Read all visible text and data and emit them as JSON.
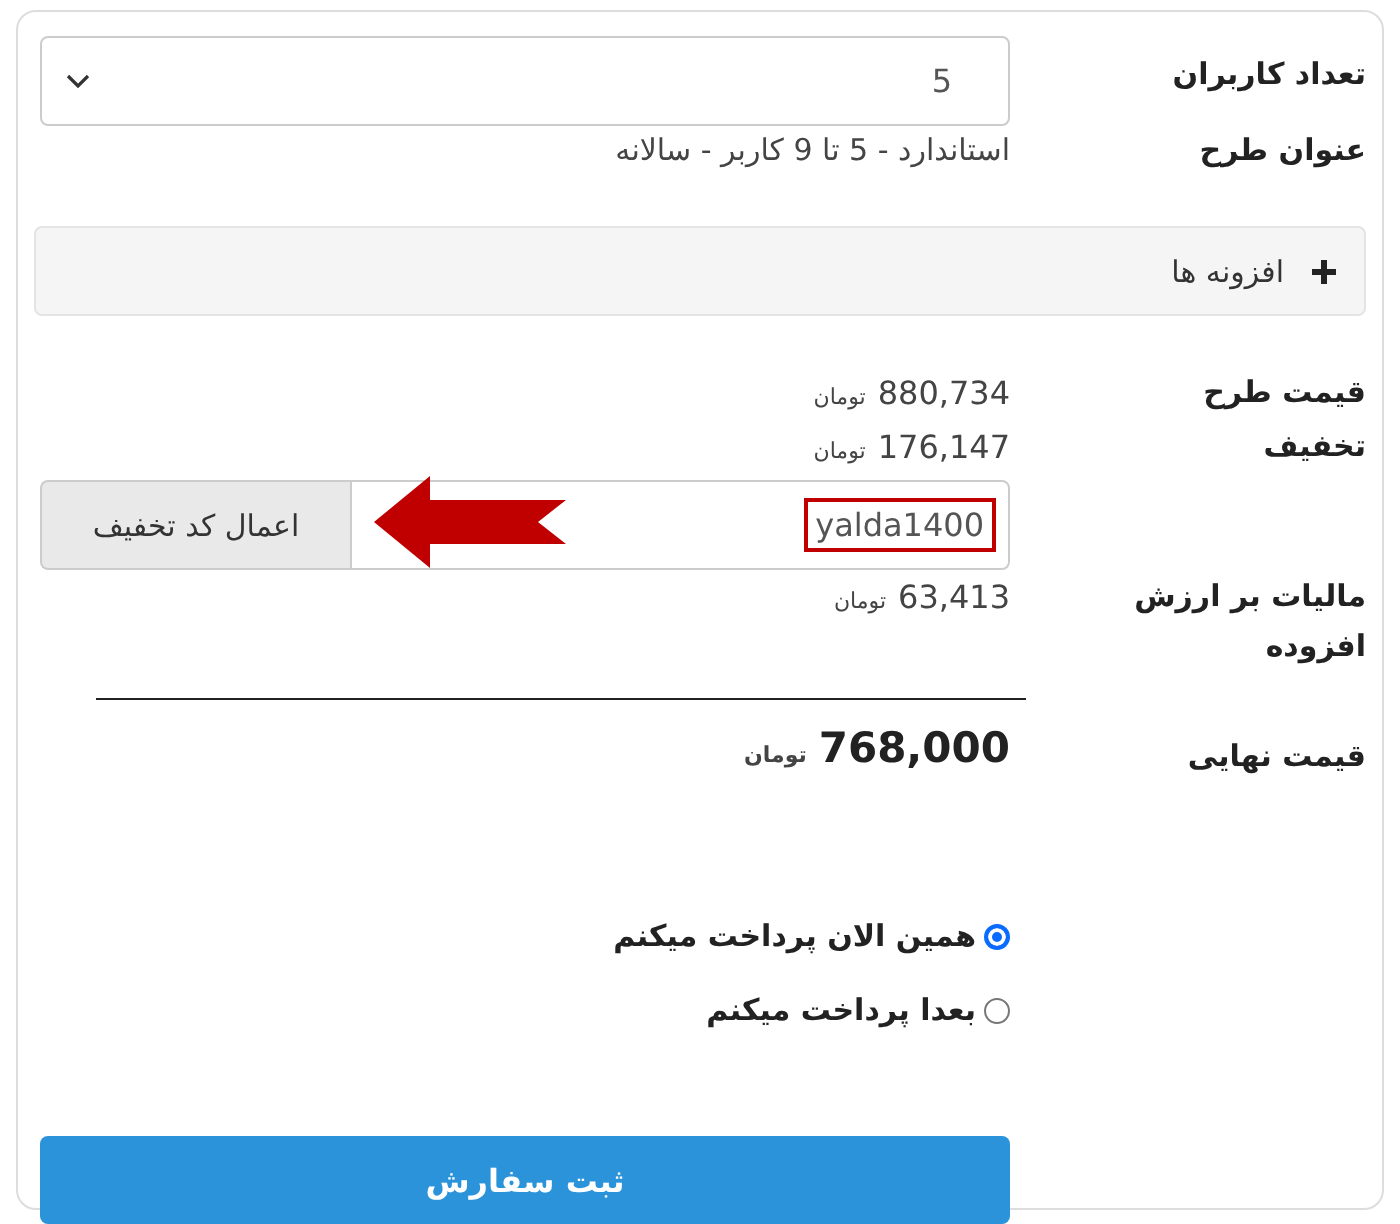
{
  "users": {
    "label": "تعداد کاربران",
    "value": "5"
  },
  "plan": {
    "label": "عنوان طرح",
    "value": "استاندارد - 5 تا 9 کاربر - سالانه"
  },
  "addons": {
    "label": "افزونه ها",
    "expanded": false
  },
  "price": {
    "label": "قیمت طرح",
    "amount": "880,734",
    "currency": "تومان"
  },
  "discount": {
    "label": "تخفیف",
    "amount": "176,147",
    "currency": "تومان",
    "code": "yalda1400",
    "apply_button": "اعمال کد تخفیف"
  },
  "tax": {
    "label": "مالیات بر ارزش افزوده",
    "amount": "63,413",
    "currency": "تومان"
  },
  "total": {
    "label": "قیمت نهایی",
    "amount": "768,000",
    "currency": "تومان"
  },
  "payment_options": [
    {
      "label": "همین الان پرداخت میکنم",
      "selected": true
    },
    {
      "label": "بعدا پرداخت میکنم",
      "selected": false
    }
  ],
  "submit": "ثبت سفارش"
}
